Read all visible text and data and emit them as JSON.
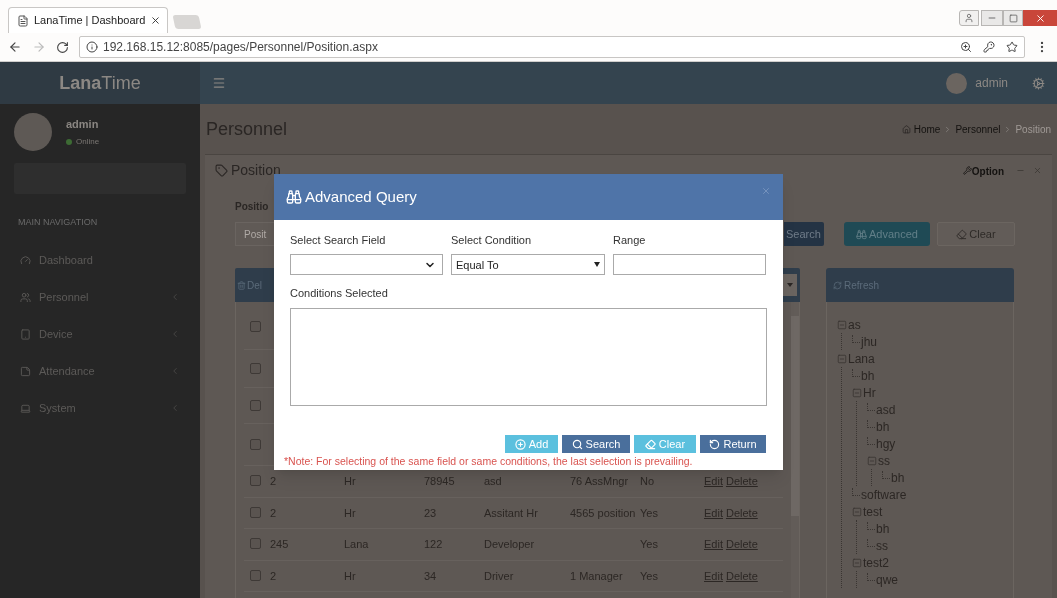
{
  "browser": {
    "tab": {
      "title": "LanaTime | Dashboard"
    },
    "url": "192.168.15.12:8085/pages/Personnel/Position.aspx"
  },
  "header": {
    "brand": "**Lana**Time",
    "user": "admin"
  },
  "sidebar": {
    "user": {
      "name": "admin",
      "status": "Online"
    },
    "section": "MAIN NAVIGATION",
    "items": [
      {
        "label": "Dashboard",
        "kind": "dashboard",
        "expandable": false
      },
      {
        "label": "Personnel",
        "kind": "personnel",
        "expandable": true
      },
      {
        "label": "Device",
        "kind": "device",
        "expandable": true
      },
      {
        "label": "Attendance",
        "kind": "attendance",
        "expandable": true
      },
      {
        "label": "System",
        "kind": "system",
        "expandable": true
      }
    ]
  },
  "page": {
    "title": "Personnel",
    "breadcrumb": [
      "Home",
      "Personnel",
      "Position"
    ]
  },
  "panel": {
    "title": "Position",
    "option": "Option"
  },
  "filter": {
    "label": "Positio",
    "placeholder": "Posit",
    "buttons": [
      {
        "label": "Search",
        "kind": "search"
      },
      {
        "label": "Advanced",
        "kind": "advanced"
      },
      {
        "label": "Clear",
        "kind": "clear"
      }
    ]
  },
  "table": {
    "delete_button": "Del",
    "hidden_rows": [
      {
        "checked": false
      },
      {
        "checked": false
      },
      {
        "checked": false
      },
      {
        "checked": false
      }
    ],
    "rows": [
      {
        "checked": false,
        "column_1": "2",
        "column_2": "Hr",
        "column_3": "78945",
        "column_4": "asd",
        "column_5": "76 AssMngr",
        "column_6": "No",
        "edit": "Edit",
        "delete": "Delete"
      },
      {
        "checked": false,
        "column_1": "2",
        "column_2": "Hr",
        "column_3": "23",
        "column_4": "Assitant Hr",
        "column_5": "4565 position",
        "column_6": "Yes",
        "edit": "Edit",
        "delete": "Delete"
      },
      {
        "checked": false,
        "column_1": "245",
        "column_2": "Lana",
        "column_3": "122",
        "column_4": "Developer",
        "column_6": "Yes",
        "edit": "Edit",
        "delete": "Delete"
      },
      {
        "checked": false,
        "column_1": "2",
        "column_2": "Hr",
        "column_3": "34",
        "column_4": "Driver",
        "column_5": "1 Manager",
        "column_6": "Yes",
        "edit": "Edit",
        "delete": "Delete"
      }
    ]
  },
  "tree": {
    "refresh": "Refresh",
    "nodes": [
      {
        "label": "as",
        "expanded": true,
        "children": [
          {
            "label": "jhu"
          }
        ]
      },
      {
        "label": "Lana",
        "expanded": true,
        "children": [
          {
            "label": "bh"
          },
          {
            "label": "Hr",
            "expanded": true,
            "children": [
              {
                "label": "asd"
              },
              {
                "label": "bh"
              },
              {
                "label": "hgy"
              },
              {
                "label": "ss",
                "expanded": true,
                "children": [
                  {
                    "label": "bh"
                  }
                ]
              }
            ]
          },
          {
            "label": "software"
          },
          {
            "label": "test",
            "expanded": true,
            "children": [
              {
                "label": "bh"
              },
              {
                "label": "ss"
              }
            ]
          },
          {
            "label": "test2",
            "expanded": true,
            "children": [
              {
                "label": "qwe"
              }
            ]
          }
        ]
      }
    ]
  },
  "modal": {
    "title": "Advanced Query",
    "fields": [
      {
        "label": "Select Search Field",
        "kind": "select"
      },
      {
        "label": "Select Condition",
        "kind": "dropdown",
        "value": "Equal To"
      },
      {
        "label": "Range",
        "kind": "text"
      }
    ],
    "conditions_label": "Conditions Selected",
    "buttons": [
      {
        "label": "Add",
        "kind": "add"
      },
      {
        "label": "Search",
        "kind": "search"
      },
      {
        "label": "Clear",
        "kind": "clear"
      },
      {
        "label": "Return",
        "kind": "return"
      }
    ],
    "note": "*Note: For selecting of the same field or same conditions, the last selection is prevailing."
  }
}
